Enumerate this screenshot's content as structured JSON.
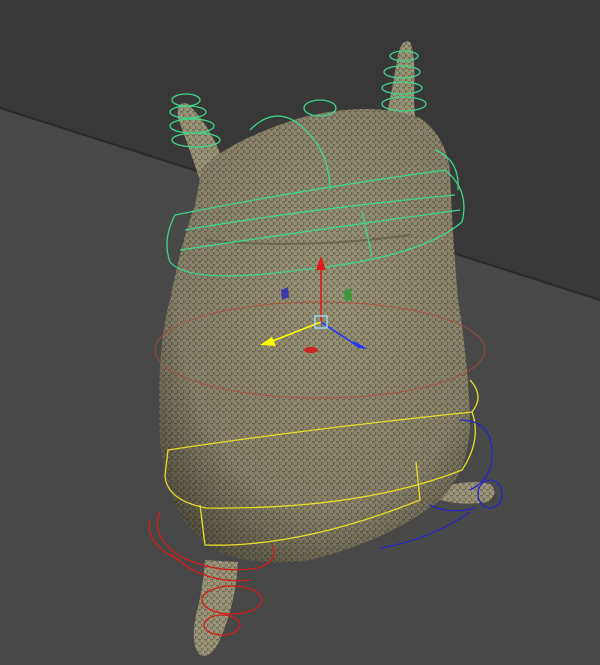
{
  "viewport": {
    "background_color": "#3a3a3a",
    "floor_color": "#4a4a4a",
    "floor_line_color": "#2c2c2c"
  },
  "model": {
    "name_icon": "sack-character-mesh",
    "material": "burlap",
    "base_color": "#8a8468",
    "shade_color": "#4e4a3a",
    "highlight_color": "#b3ad8f"
  },
  "rig": {
    "head_controls_color": "#3fd68a",
    "hip_control_color": "#e6dd2a",
    "left_foot_control_color": "#d41d1d",
    "right_foot_control_color": "#2424c8",
    "waist_control_color": "#b44a3a"
  },
  "manipulator": {
    "icon": "move-tool-gizmo",
    "x_axis_color": "#ffff00",
    "y_axis_color": "#e01c1c",
    "z_axis_color": "#2233ff",
    "plane_handle_colors": [
      "#3a3aaa",
      "#3a9a3a",
      "#cc2222"
    ]
  }
}
